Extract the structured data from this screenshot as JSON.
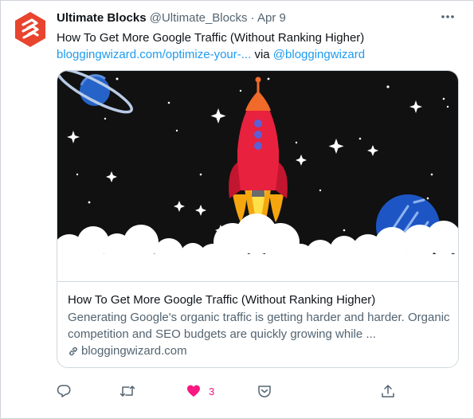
{
  "tweet": {
    "author_name": "Ultimate Blocks",
    "author_handle": "@Ultimate_Blocks",
    "separator": "·",
    "date": "Apr 9",
    "title_line": "How To Get More Google Traffic (Without Ranking Higher)",
    "link_text": "bloggingwizard.com/optimize-your-...",
    "via_text": "via",
    "mention": "@bloggingwizard"
  },
  "card": {
    "title": "How To Get More Google Traffic (Without Ranking Higher)",
    "description": "Generating Google's organic traffic is getting harder and harder. Organic competition and SEO budgets are quickly growing while ...",
    "domain": "bloggingwizard.com"
  },
  "actions": {
    "like_count": "3"
  },
  "colors": {
    "accent": "#1d9bf0",
    "like": "#f91880",
    "avatar": "#e8442e",
    "rocket": "#e8213f",
    "space": "#111111"
  },
  "icons": [
    "ultimate-blocks-logo",
    "more-icon",
    "link-icon",
    "reply-icon",
    "retweet-icon",
    "heart-icon",
    "bookmark-icon",
    "share-icon"
  ]
}
